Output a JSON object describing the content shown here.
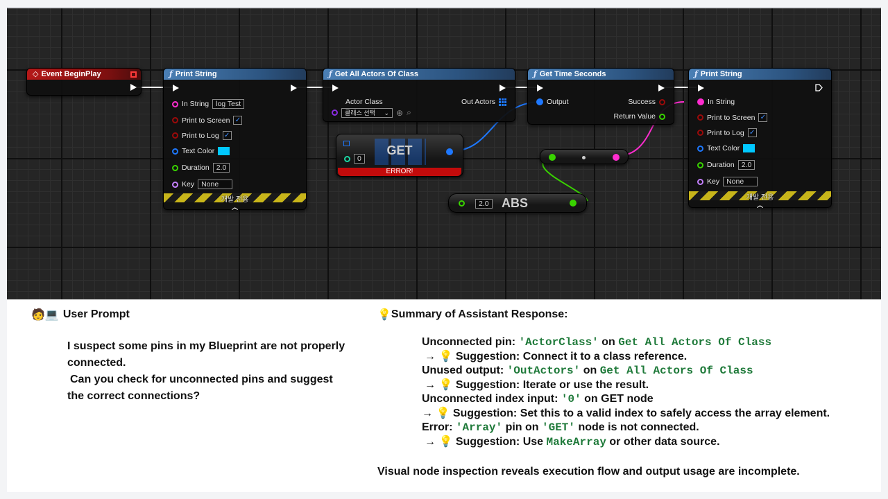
{
  "nodes": {
    "event_begin": {
      "title": "Event BeginPlay"
    },
    "print1": {
      "title": "Print String",
      "in_string_label": "In String",
      "in_string_value": "log Test",
      "print_screen_label": "Print to Screen",
      "print_log_label": "Print to Log",
      "text_color_label": "Text Color",
      "duration_label": "Duration",
      "duration_value": "2.0",
      "key_label": "Key",
      "key_value": "None",
      "dev_label": "개발 전용",
      "check_mark": "✓",
      "caret": "︿"
    },
    "get_all": {
      "title": "Get All Actors Of Class",
      "actor_class_label": "Actor Class",
      "out_actors_label": "Out Actors",
      "class_select": "클래스 선택",
      "select_arrow": "⌄",
      "circle_plus": "⊕",
      "search_glyph": "⌕"
    },
    "get_time": {
      "title": "Get Time Seconds",
      "output_label": "Output",
      "success_label": "Success",
      "return_label": "Return Value"
    },
    "print2": {
      "title": "Print String",
      "in_string_label": "In String",
      "print_screen_label": "Print to Screen",
      "print_log_label": "Print to Log",
      "text_color_label": "Text Color",
      "duration_label": "Duration",
      "duration_value": "2.0",
      "key_label": "Key",
      "key_value": "None",
      "dev_label": "개발 전용",
      "check_mark": "✓",
      "caret": "︿"
    },
    "get_node": {
      "title": "GET",
      "index_value": "0",
      "error": "ERROR!"
    },
    "abs_node": {
      "title": "ABS",
      "value": "2.0"
    }
  },
  "colors": {
    "exec": "#ffffff",
    "string": "#ff2ccf",
    "bool": "#9b0a0a",
    "struct": "#1e78ff",
    "float": "#39d300",
    "name": "#c480ff",
    "class": "#8a2be2",
    "error": "#c20b0b"
  },
  "prompt": {
    "icons": "🧑💻",
    "heading": "User Prompt",
    "lines": [
      "I suspect some pins in my Blueprint are not properly",
      "connected.",
      "Can you check for unconnected pins and suggest",
      "the correct connections?"
    ]
  },
  "summary": {
    "icon": "💡",
    "heading": "Summary of Assistant Response:",
    "item1": {
      "a": "Unconnected pin: ",
      "b": "'ActorClass'",
      "c": " on ",
      "d": "Get All Actors Of Class"
    },
    "sug1": {
      "arrow": "→ ",
      "icon": "💡",
      "text": " Suggestion: Connect it to a class reference."
    },
    "item2": {
      "a": "Unused output: ",
      "b": "'OutActors'",
      "c": " on ",
      "d": "Get All Actors Of Class"
    },
    "sug2": {
      "arrow": "→ ",
      "icon": "💡",
      "text": " Suggestion: Iterate or use the result."
    },
    "item3": {
      "a": "Unconnected index input: ",
      "b": "'0'",
      "c": " on GET node"
    },
    "sug3": {
      "arrow": "→ ",
      "icon": "💡",
      "text": " Suggestion: Set this to a valid index to safely access the array element."
    },
    "item4": {
      "a": "Error: ",
      "b": "'Array'",
      "c": " pin on ",
      "d": "'GET'",
      "e": " node is not connected."
    },
    "sug4": {
      "arrow": "→ ",
      "icon": "💡",
      "a": " Suggestion: Use ",
      "b": "MakeArray",
      "c": " or other data source."
    },
    "conclusion": "Visual node inspection reveals execution flow and output usage are incomplete."
  }
}
